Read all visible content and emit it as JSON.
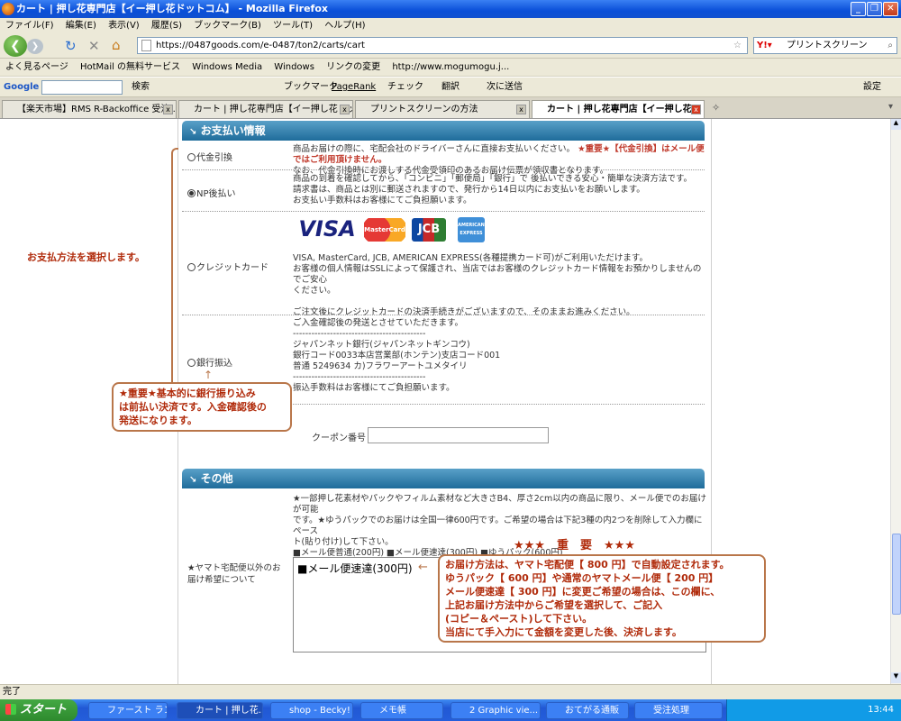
{
  "window": {
    "title": "カート | 押し花専門店【イー押し花ドットコム】 - Mozilla Firefox"
  },
  "menu": [
    "ファイル(F)",
    "編集(E)",
    "表示(V)",
    "履歴(S)",
    "ブックマーク(B)",
    "ツール(T)",
    "ヘルプ(H)"
  ],
  "address": {
    "url": "https://0487goods.com/e-0487/ton2/carts/cart"
  },
  "search": {
    "placeholder": "プリントスクリーン"
  },
  "bookmarks": [
    "よく見るページ",
    "HotMail の無料サービス",
    "Windows Media",
    "Windows",
    "リンクの変更",
    "http://www.mogumogu.j..."
  ],
  "googlebar": {
    "logo": "Google",
    "search": "検索",
    "bookmarks": "ブックマーク",
    "pagerank": "PageRank",
    "check": "チェック",
    "translate": "翻訳",
    "send": "次に送信",
    "settings": "設定"
  },
  "tabs": [
    {
      "label": "【楽天市場】RMS R-Backoffice 受注..."
    },
    {
      "label": "カート | 押し花専門店【イー押し花ドット..."
    },
    {
      "label": "プリントスクリーンの方法"
    },
    {
      "label": "カート | 押し花専門店【イー押し花..."
    }
  ],
  "payment": {
    "title": "お支払い情報",
    "options": [
      {
        "label": "代金引換",
        "selected": false,
        "desc1": "商品お届けの際に、宅配会社のドライバーさんに直接お支払いください。",
        "warn": "★重要★【代金引換】はメール便ではご利用頂けません。",
        "desc2": "なお、代金引換時にお渡しする代金受領印のあるお届け伝票が領収書となります。"
      },
      {
        "label": "NP後払い",
        "selected": true,
        "lines": [
          "商品の到着を確認してから、「コンビニ」「郵便局」「銀行」で 後払いできる安心・簡単な決済方法です。",
          "請求書は、商品とは別に郵送されますので、発行から14日以内にお支払いをお願いします。",
          "お支払い手数料はお客様にてご負担願います。"
        ]
      },
      {
        "label": "クレジットカード",
        "selected": false,
        "cards": [
          "VISA",
          "MasterCard",
          "JCB",
          "AMERICAN EXPRESS"
        ],
        "lines": [
          "VISA, MasterCard, JCB, AMERICAN EXPRESS(各種提携カード可)がご利用いただけます。",
          "お客様の個人情報はSSLによって保護され、当店ではお客様のクレジットカード情報をお預かりしませんのでご安心",
          "ください。",
          "",
          "ご注文後にクレジットカードの決済手続きがございますので、そのままお進みください。"
        ]
      },
      {
        "label": "銀行振込",
        "selected": false,
        "lines": [
          "ご入金確認後の発送とさせていただきます。",
          "-------------------------------------------",
          "ジャパンネット銀行(ジャパンネットギンコウ)",
          "銀行コード0033本店営業部(ホンテン)支店コード001",
          "普通 5249634  カ)フラワーアートユメタイリ",
          "-------------------------------------------",
          "振込手数料はお客様にてご負担願います。"
        ]
      }
    ],
    "coupon_label": "クーポン番号",
    "coupon_value": ""
  },
  "notes": {
    "select": "お支払方法を選択します。",
    "bank": [
      "★重要★基本的に銀行振り込み",
      "は前払い決済です。入金確認後の",
      "発送になります。"
    ],
    "important": "★★★　重　要　★★★",
    "delivery": [
      "お届け方法は、ヤマト宅配便【 800 円】で自動設定されます。",
      "ゆうパック【 600 円】や通常のヤマトメール便【 200 円】",
      "メール便速達【 300 円】に変更ご希望の場合は、この欄に、",
      "上記お届け方法中からご希望を選択して、ご記入",
      "(コピー＆ペースト)して下さい。",
      "当店にて手入力にて金額を変更した後、決済します。"
    ]
  },
  "other": {
    "title": "その他",
    "info": [
      "★一部押し花素材やパックやフィルム素材など大きさB4、厚さ2cm以内の商品に限り、メール便でのお届けが可能",
      "です。★ゆうパックでのお届けは全国一律600円です。ご希望の場合は下記3種の内2つを削除して入力欄にペース",
      "ト(貼り付け)して下さい。",
      "■メール便普通(200円)  ■メール便速達(300円)  ■ゆうパック(600円)"
    ],
    "delivery_label": [
      "★ヤマト宅配便以外のお",
      "届け希望について"
    ],
    "textarea_value": "■メール便速達(300円)"
  },
  "status": "完了",
  "taskbar": {
    "start": "スタート",
    "items": [
      "ファースト ラン",
      "カート | 押し花...",
      "shop - Becky!",
      "メモ帳",
      "2 Graphic vie...",
      "おてがる通販",
      "受注処理"
    ],
    "clock": "13:44"
  }
}
